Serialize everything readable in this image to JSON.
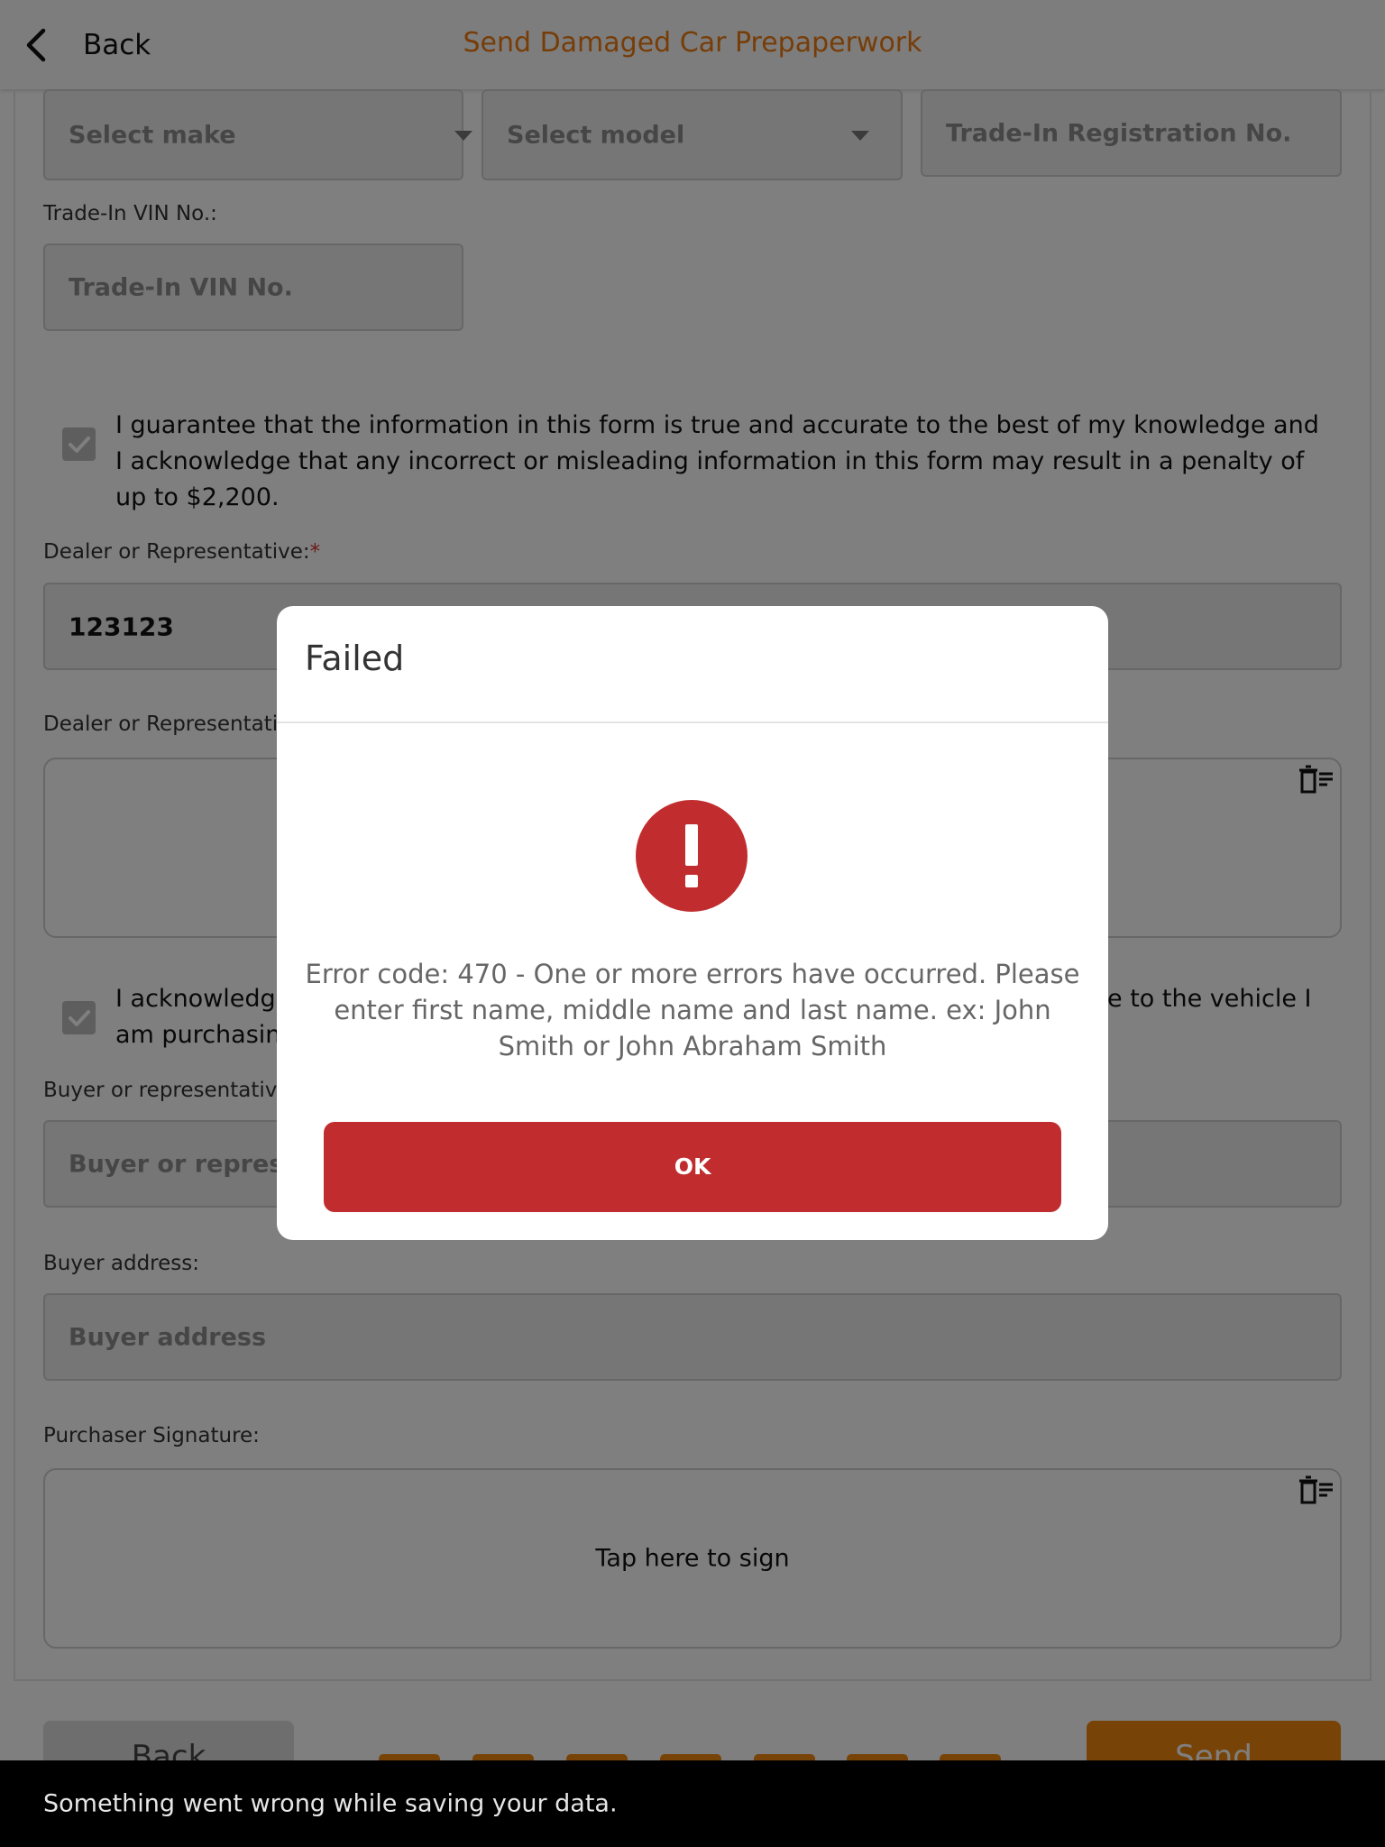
{
  "header": {
    "back_label": "Back",
    "title": "Send Damaged Car Prepaperwork"
  },
  "form": {
    "make_placeholder": "Select make",
    "model_placeholder": "Select model",
    "tradein_reg_placeholder": "Trade-In Registration No.",
    "tradein_vin_label": "Trade-In VIN No.:",
    "tradein_vin_placeholder": "Trade-In VIN No.",
    "guarantee_text": "I guarantee that the information in this form is true and accurate to the best of my knowledge and I acknowledge that any incorrect or misleading information in this form may result in a penalty of up to $2,200.",
    "dealer_label": "Dealer or Representative:",
    "required_mark": "*",
    "dealer_value": "123123",
    "dealer_sig_label": "Dealer or Representativ",
    "acknowledge_text_left": "I acknowledg",
    "acknowledge_text_left2": "am purchasin",
    "acknowledge_text_right": "e to the vehicle I",
    "buyer_label": "Buyer or representativ",
    "buyer_placeholder": "Buyer or represe",
    "buyer_address_label": "Buyer address:",
    "buyer_address_placeholder": "Buyer address",
    "purchaser_sig_label": "Purchaser Signature:",
    "tap_to_sign": "Tap here to sign",
    "back_button": "Back",
    "send_button": "Send"
  },
  "dialog": {
    "title": "Failed",
    "message": "Error code: 470 - One or more errors have occurred. Please enter first name, middle name and last name. ex: John Smith or John Abraham Smith",
    "ok_label": "OK",
    "icon": "error-exclamation-icon"
  },
  "snackbar": {
    "message": "Something went wrong while saving your data."
  },
  "colors": {
    "accent": "#ee7a10",
    "error": "#c12d2f"
  }
}
